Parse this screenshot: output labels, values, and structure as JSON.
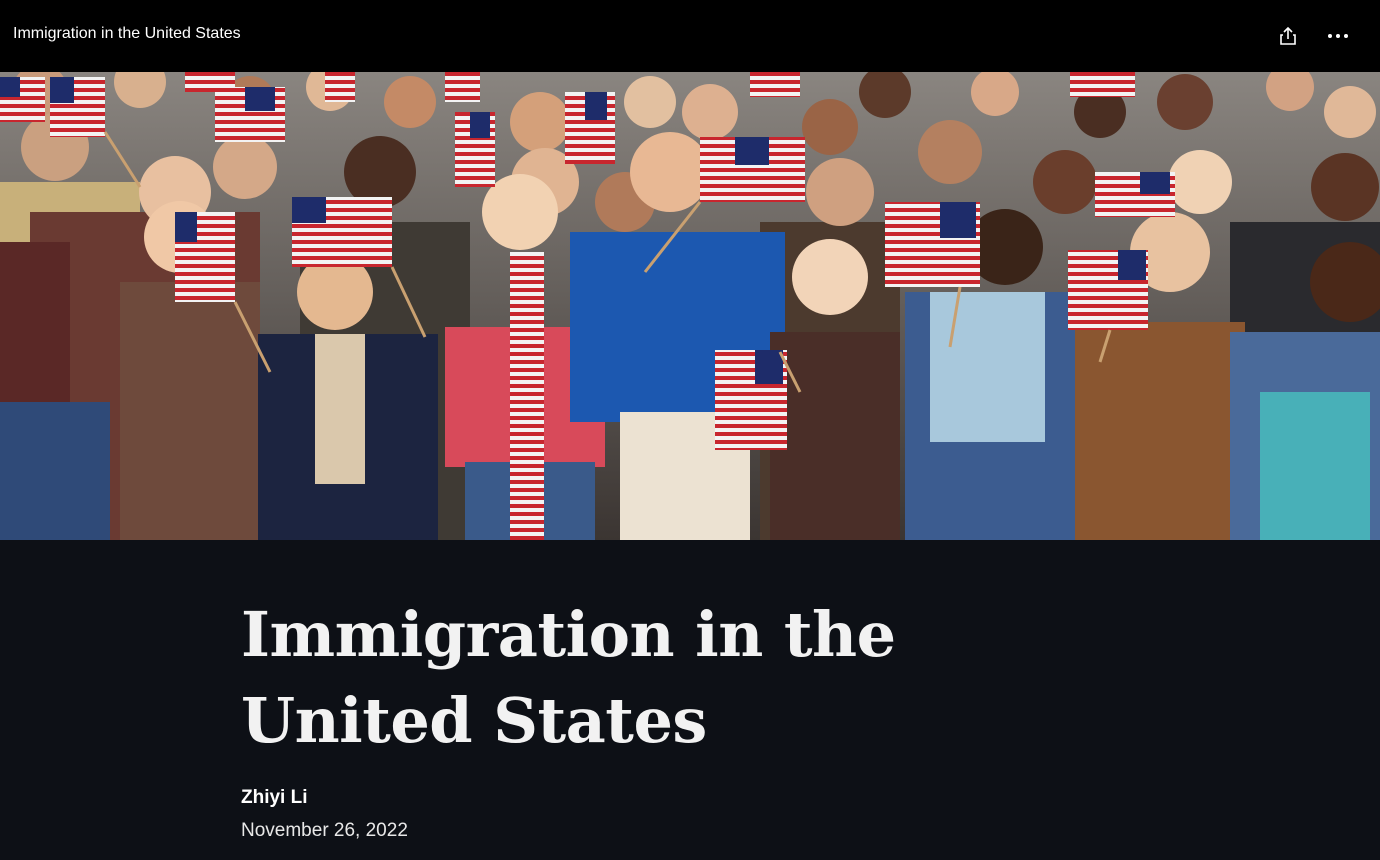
{
  "topbar": {
    "title": "Immigration in the United States",
    "share_icon": "share-icon",
    "more_icon": "more-horizontal-icon"
  },
  "hero": {
    "image_subject": "crowd waving American flags"
  },
  "article": {
    "title": "Immigration in the United States",
    "author": "Zhiyi Li",
    "date": "November 26, 2022"
  },
  "colors": {
    "topbar_bg": "#000000",
    "page_bg": "#0d1016",
    "title_text": "#f2f2f2"
  }
}
